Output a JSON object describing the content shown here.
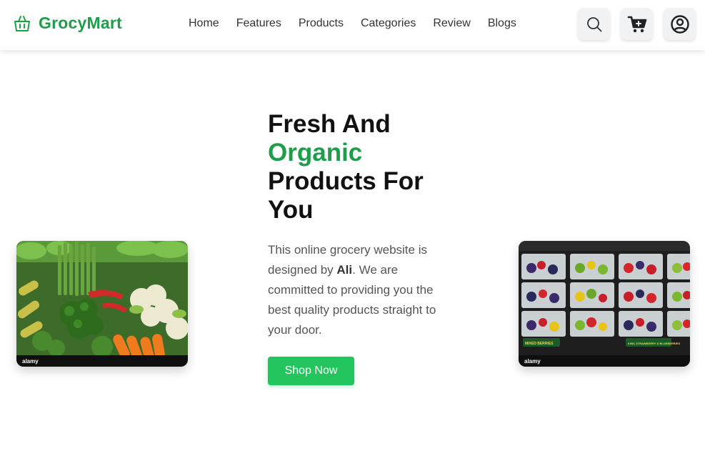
{
  "brand": {
    "name": "GrocyMart",
    "icon": "basket-icon",
    "color": "#1e9e4a"
  },
  "nav": {
    "items": [
      {
        "label": "Home"
      },
      {
        "label": "Features"
      },
      {
        "label": "Products"
      },
      {
        "label": "Categories"
      },
      {
        "label": "Review"
      },
      {
        "label": "Blogs"
      }
    ]
  },
  "header_actions": {
    "search_icon": "search-icon",
    "cart_icon": "cart-icon",
    "user_icon": "user-circle-icon"
  },
  "hero": {
    "title_part1": "Fresh And",
    "title_accent": "Organic",
    "title_part2": "Products For You",
    "desc_before": "This online grocery website is designed by ",
    "desc_bold": "Ali",
    "desc_after": ". We are committed to providing you the best quality products straight to your door.",
    "cta_label": "Shop Now",
    "cta_color": "#22c55e"
  },
  "images": {
    "left": {
      "watermark": "alamy"
    },
    "right": {
      "watermark": "alamy",
      "labels": [
        "MIXED BERRIES",
        "KIWI, STRAWBERRY & BLUEBERRIES"
      ]
    }
  }
}
